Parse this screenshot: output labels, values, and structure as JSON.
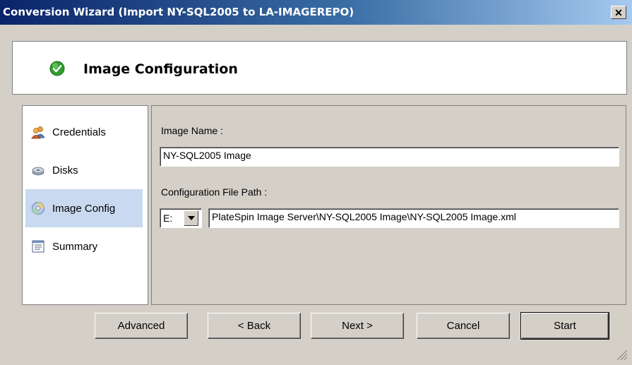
{
  "window": {
    "title": "Conversion Wizard (Import NY-SQL2005 to LA-IMAGEREPO)",
    "close_label": "✕"
  },
  "header": {
    "title": "Image Configuration",
    "icon": "check-circle-icon"
  },
  "nav": {
    "items": [
      {
        "label": "Credentials",
        "icon": "users-icon",
        "active": false
      },
      {
        "label": "Disks",
        "icon": "disk-icon",
        "active": false
      },
      {
        "label": "Image Config",
        "icon": "cd-icon",
        "active": true
      },
      {
        "label": "Summary",
        "icon": "summary-icon",
        "active": false
      }
    ]
  },
  "form": {
    "image_name_label": "Image Name :",
    "image_name_value": "NY-SQL2005 Image",
    "config_path_label": "Configuration File Path :",
    "drive_value": "E:",
    "config_path_value": "PlateSpin Image Server\\NY-SQL2005 Image\\NY-SQL2005 Image.xml"
  },
  "buttons": {
    "advanced": "Advanced",
    "back": "< Back",
    "next": "Next >",
    "cancel": "Cancel",
    "start": "Start"
  },
  "colors": {
    "titlebar_start": "#0a246a",
    "titlebar_end": "#a6caf0",
    "active_nav": "#c8d9f0",
    "face": "#d4d0c8"
  }
}
